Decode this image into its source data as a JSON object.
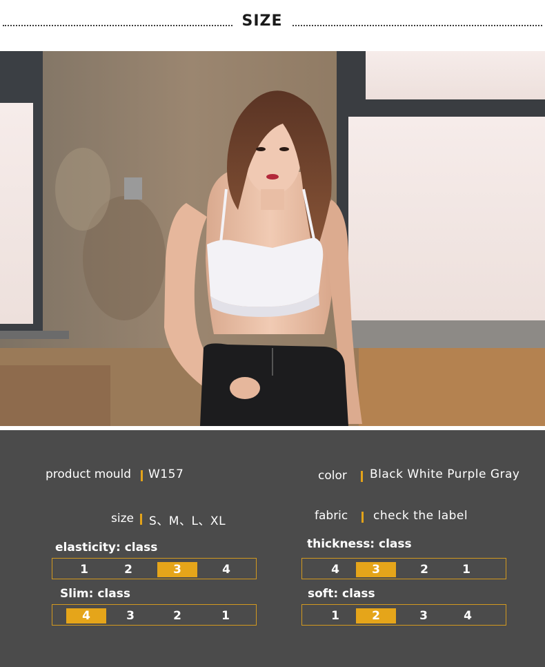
{
  "header": {
    "title": "SIZE"
  },
  "info": {
    "product_mould_label": "product mould",
    "product_mould_value": "W157",
    "color_label": "color",
    "color_value": "Black White Purple Gray",
    "size_label": "size",
    "size_value": "S、M、L、XL",
    "fabric_label": "fabric",
    "fabric_value": "check the label"
  },
  "ratings": {
    "elasticity": {
      "title": "elasticity:  class",
      "cells": [
        "1",
        "2",
        "3",
        "4"
      ],
      "selected": "3"
    },
    "thickness": {
      "title": "thickness:  class",
      "cells": [
        "4",
        "3",
        "2",
        "1"
      ],
      "selected": "3"
    },
    "slim": {
      "title": "Slim:  class",
      "cells": [
        "4",
        "3",
        "2",
        "1"
      ],
      "selected": "4"
    },
    "soft": {
      "title": "soft:  class",
      "cells": [
        "1",
        "2",
        "3",
        "4"
      ],
      "selected": "2"
    }
  },
  "colors": {
    "panel_bg": "#4b4b4b",
    "accent": "#e5a51a"
  }
}
